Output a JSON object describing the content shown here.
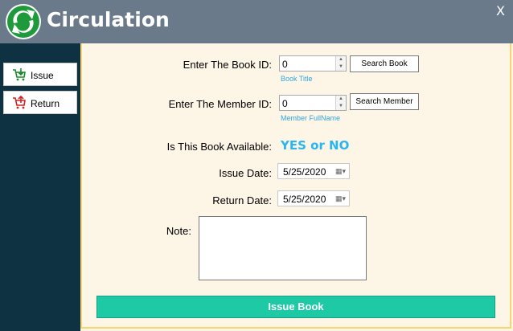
{
  "window": {
    "title": "Circulation",
    "close_label": "X"
  },
  "sidebar": {
    "items": [
      {
        "label": "Issue",
        "icon": "cart-add-icon",
        "color": "#1a8a2a"
      },
      {
        "label": "Return",
        "icon": "cart-remove-icon",
        "color": "#d42020"
      }
    ]
  },
  "form": {
    "book_id_label": "Enter The Book ID:",
    "book_id_value": "0",
    "book_title_hint": "Book Title",
    "search_book_label": "Search Book",
    "member_id_label": "Enter The Member ID:",
    "member_id_value": "0",
    "member_hint": "Member FullName",
    "search_member_label": "Search Member",
    "available_label": "Is This Book Available:",
    "available_value": "YES or NO",
    "issue_date_label": "Issue Date:",
    "issue_date_value": "5/25/2020",
    "return_date_label": "Return Date:",
    "return_date_value": "5/25/2020",
    "note_label": "Note:",
    "note_value": ""
  },
  "actions": {
    "issue_book_label": "Issue Book"
  },
  "colors": {
    "header": "#6b7a8a",
    "sidebar": "#0e3242",
    "accent": "#1ec9a5",
    "hint": "#2fa8e0",
    "content_bg": "#fdf5e6"
  }
}
